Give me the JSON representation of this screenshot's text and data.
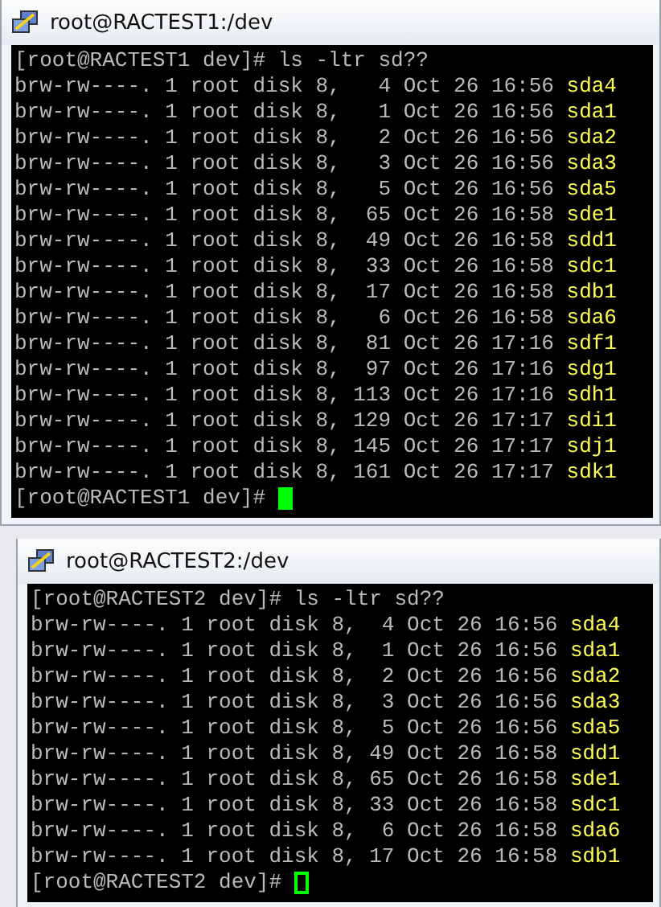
{
  "windows": [
    {
      "title": "root@RACTEST1:/dev",
      "lines": [
        {
          "kind": "prompt",
          "text": "[root@RACTEST1 dev]# ls -ltr sd??"
        },
        {
          "kind": "entry",
          "text": "brw-rw----. 1 root disk 8,   4 Oct 26 16:56",
          "device": "sda4"
        },
        {
          "kind": "entry",
          "text": "brw-rw----. 1 root disk 8,   1 Oct 26 16:56",
          "device": "sda1"
        },
        {
          "kind": "entry",
          "text": "brw-rw----. 1 root disk 8,   2 Oct 26 16:56",
          "device": "sda2"
        },
        {
          "kind": "entry",
          "text": "brw-rw----. 1 root disk 8,   3 Oct 26 16:56",
          "device": "sda3"
        },
        {
          "kind": "entry",
          "text": "brw-rw----. 1 root disk 8,   5 Oct 26 16:56",
          "device": "sda5"
        },
        {
          "kind": "entry",
          "text": "brw-rw----. 1 root disk 8,  65 Oct 26 16:58",
          "device": "sde1"
        },
        {
          "kind": "entry",
          "text": "brw-rw----. 1 root disk 8,  49 Oct 26 16:58",
          "device": "sdd1"
        },
        {
          "kind": "entry",
          "text": "brw-rw----. 1 root disk 8,  33 Oct 26 16:58",
          "device": "sdc1"
        },
        {
          "kind": "entry",
          "text": "brw-rw----. 1 root disk 8,  17 Oct 26 16:58",
          "device": "sdb1"
        },
        {
          "kind": "entry",
          "text": "brw-rw----. 1 root disk 8,   6 Oct 26 16:58",
          "device": "sda6"
        },
        {
          "kind": "entry",
          "text": "brw-rw----. 1 root disk 8,  81 Oct 26 17:16",
          "device": "sdf1"
        },
        {
          "kind": "entry",
          "text": "brw-rw----. 1 root disk 8,  97 Oct 26 17:16",
          "device": "sdg1"
        },
        {
          "kind": "entry",
          "text": "brw-rw----. 1 root disk 8, 113 Oct 26 17:16",
          "device": "sdh1"
        },
        {
          "kind": "entry",
          "text": "brw-rw----. 1 root disk 8, 129 Oct 26 17:17",
          "device": "sdi1"
        },
        {
          "kind": "entry",
          "text": "brw-rw----. 1 root disk 8, 145 Oct 26 17:17",
          "device": "sdj1"
        },
        {
          "kind": "entry",
          "text": "brw-rw----. 1 root disk 8, 161 Oct 26 17:17",
          "device": "sdk1"
        },
        {
          "kind": "cursor",
          "text": "[root@RACTEST1 dev]#",
          "cursor_filled": true
        }
      ]
    },
    {
      "title": "root@RACTEST2:/dev",
      "lines": [
        {
          "kind": "prompt",
          "text": "[root@RACTEST2 dev]# ls -ltr sd??"
        },
        {
          "kind": "entry",
          "text": "brw-rw----. 1 root disk 8,  4 Oct 26 16:56",
          "device": "sda4"
        },
        {
          "kind": "entry",
          "text": "brw-rw----. 1 root disk 8,  1 Oct 26 16:56",
          "device": "sda1"
        },
        {
          "kind": "entry",
          "text": "brw-rw----. 1 root disk 8,  2 Oct 26 16:56",
          "device": "sda2"
        },
        {
          "kind": "entry",
          "text": "brw-rw----. 1 root disk 8,  3 Oct 26 16:56",
          "device": "sda3"
        },
        {
          "kind": "entry",
          "text": "brw-rw----. 1 root disk 8,  5 Oct 26 16:56",
          "device": "sda5"
        },
        {
          "kind": "entry",
          "text": "brw-rw----. 1 root disk 8, 49 Oct 26 16:58",
          "device": "sdd1"
        },
        {
          "kind": "entry",
          "text": "brw-rw----. 1 root disk 8, 65 Oct 26 16:58",
          "device": "sde1"
        },
        {
          "kind": "entry",
          "text": "brw-rw----. 1 root disk 8, 33 Oct 26 16:58",
          "device": "sdc1"
        },
        {
          "kind": "entry",
          "text": "brw-rw----. 1 root disk 8,  6 Oct 26 16:58",
          "device": "sda6"
        },
        {
          "kind": "entry",
          "text": "brw-rw----. 1 root disk 8, 17 Oct 26 16:58",
          "device": "sdb1"
        },
        {
          "kind": "cursor",
          "text": "[root@RACTEST2 dev]#",
          "cursor_filled": false
        }
      ]
    }
  ]
}
